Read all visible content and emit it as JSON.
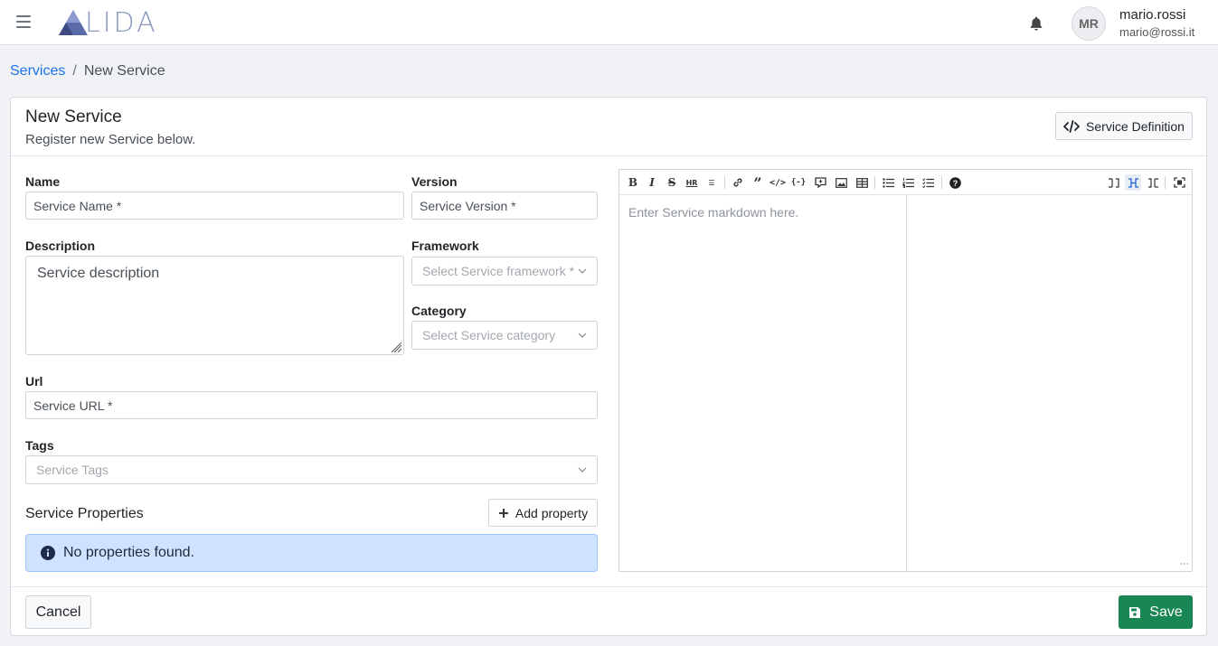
{
  "app": {
    "logo_text": "LIDA"
  },
  "user": {
    "initials": "MR",
    "name": "mario.rossi",
    "email": "mario@rossi.it"
  },
  "breadcrumb": {
    "parent": "Services",
    "separator": "/",
    "current": "New Service"
  },
  "card": {
    "title": "New Service",
    "subtitle": "Register new Service below.",
    "definition_button": "Service Definition"
  },
  "form": {
    "name": {
      "label": "Name",
      "placeholder": "Service Name *"
    },
    "version": {
      "label": "Version",
      "placeholder": "Service Version *"
    },
    "description": {
      "label": "Description",
      "placeholder": "Service description"
    },
    "framework": {
      "label": "Framework",
      "placeholder": "Select Service framework *"
    },
    "category": {
      "label": "Category",
      "placeholder": "Select Service category"
    },
    "url": {
      "label": "Url",
      "placeholder": "Service URL *"
    },
    "tags": {
      "label": "Tags",
      "placeholder": "Service Tags"
    }
  },
  "properties": {
    "title": "Service Properties",
    "add_button": "Add property",
    "empty_message": "No properties found."
  },
  "editor": {
    "placeholder": "Enter Service markdown here.",
    "toolbar": [
      "bold-icon",
      "italic-icon",
      "strikethrough-icon",
      "hr-icon",
      "title-icon",
      "link-icon",
      "quote-icon",
      "code-icon",
      "code-block-icon",
      "comment-icon",
      "image-icon",
      "table-icon",
      "unordered-list-icon",
      "ordered-list-icon",
      "checked-list-icon",
      "help-icon",
      "edit-mode-icon",
      "live-mode-icon",
      "preview-mode-icon",
      "fullscreen-icon"
    ]
  },
  "footer": {
    "cancel_label": "Cancel",
    "save_label": "Save"
  },
  "colors": {
    "primary_link": "#1a73e8",
    "save": "#198754",
    "alert_bg": "#cfe2ff"
  }
}
